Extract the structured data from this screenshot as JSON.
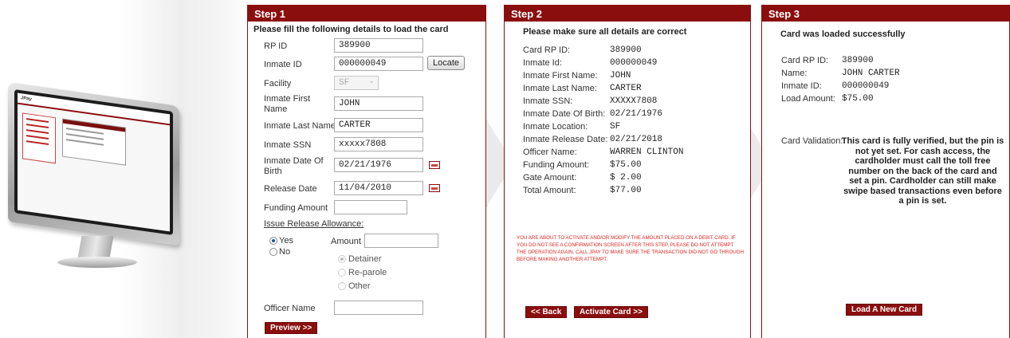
{
  "step1": {
    "header": "Step 1",
    "instruction": "Please fill the following details to load the card",
    "rp_id": {
      "label": "RP ID",
      "value": "389900"
    },
    "inmate_id": {
      "label": "Inmate ID",
      "value": "000000049"
    },
    "locate_button": "Locate",
    "facility": {
      "label": "Facility",
      "value": "SF"
    },
    "first_name": {
      "label": "Inmate First Name",
      "value": "JOHN"
    },
    "last_name": {
      "label": "Inmate Last Name",
      "value": "CARTER"
    },
    "ssn": {
      "label": "Inmate SSN",
      "value": "xxxxx7808"
    },
    "dob": {
      "label": "Inmate Date Of Birth",
      "value": "02/21/1976"
    },
    "release_date": {
      "label": "Release Date",
      "value": "11/04/2010"
    },
    "funding_amount": {
      "label": "Funding Amount",
      "value": ""
    },
    "issue_release_allowance": "Issue Release Allowance:",
    "yes_label": "Yes",
    "no_label": "No",
    "amount_label": "Amount",
    "amount_value": "",
    "detainer_label": "Detainer",
    "reparole_label": "Re-parole",
    "other_label": "Other",
    "officer_name": {
      "label": "Officer Name",
      "value": ""
    },
    "preview_button": "Preview >>"
  },
  "step2": {
    "header": "Step 2",
    "instruction": "Please make sure all details are correct",
    "details": [
      {
        "label": "Card RP ID:",
        "value": "389900"
      },
      {
        "label": "Inmate Id:",
        "value": "000000049"
      },
      {
        "label": "Inmate First Name:",
        "value": "JOHN"
      },
      {
        "label": "Inmate Last Name:",
        "value": "CARTER"
      },
      {
        "label": "Inmate SSN:",
        "value": "XXXXX7808"
      },
      {
        "label": "Inmate Date Of Birth:",
        "value": "02/21/1976"
      },
      {
        "label": "Inmate Location:",
        "value": "SF"
      },
      {
        "label": "Inmate Release Date:",
        "value": "02/21/2018"
      },
      {
        "label": "Officer Name:",
        "value": "WARREN CLINTON"
      },
      {
        "label": "Funding Amount:",
        "value": "$75.00"
      },
      {
        "label": "Gate Amount:",
        "value": "$ 2.00"
      },
      {
        "label": "Total Amount:",
        "value": "$77.00"
      }
    ],
    "warning": "YOU ARE ABOUT TO ACTIVATE AND/OR MODIFY THE AMOUNT PLACED ON A DEBIT CARD. IF YOU DO NOT SEE A CONFIRMATION SCREEN AFTER THIS STEP, PLEASE DO NOT ATTEMPT THE OPERATION AGAIN. CALL JPAY TO MAKE SURE THE TRANSACTION DID NOT GO THROUGH BEFORE MAKING ANOTHER ATTEMPT.",
    "back_button": "<< Back",
    "activate_button": "Activate Card >>"
  },
  "step3": {
    "header": "Step 3",
    "instruction": "Card was loaded successfully",
    "details": [
      {
        "label": "Card RP ID:",
        "value": "389900"
      },
      {
        "label": "Name:",
        "value": "JOHN CARTER"
      },
      {
        "label": "Inmate ID:",
        "value": "000000049"
      },
      {
        "label": "Load Amount:",
        "value": "$75.00"
      }
    ],
    "validation_label": "Card Validation:",
    "validation_text": "This card is fully verified, but the pin is not yet set. For cash access, the cardholder must call the toll free number on the back of the card and set a pin. Cardholder can still make swipe based transactions even before a pin is set.",
    "load_new_button": "Load A New Card"
  },
  "monitor_screen": {
    "brand": "JPay"
  },
  "colors": {
    "accent": "#8b0e0e",
    "warning": "#e0231c",
    "radio_selected": "#1a4fa0"
  }
}
